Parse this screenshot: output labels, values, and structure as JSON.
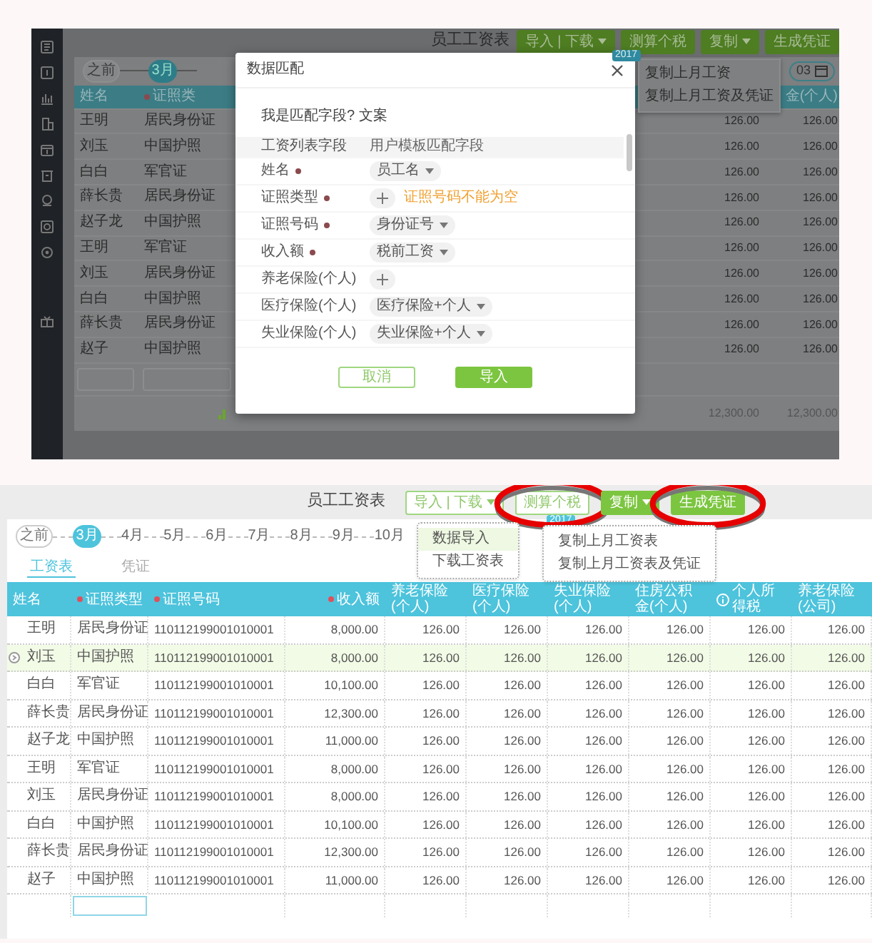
{
  "top_screen": {
    "title": "员工工资表",
    "buttons": [
      {
        "label": "导入 | 下载",
        "kind": "solid",
        "caret": true
      },
      {
        "label": "测算个税",
        "kind": "solid",
        "caret": false
      },
      {
        "label": "复制",
        "kind": "solid",
        "caret": true
      },
      {
        "label": "生成凭证",
        "kind": "solid",
        "caret": false
      }
    ],
    "badge": "2017",
    "timeline": [
      {
        "label": "之前",
        "selected": false
      },
      {
        "label": "3月",
        "selected": true
      }
    ],
    "date_field": "03",
    "copy_menu": [
      "复制上月工资",
      "复制上月工资及凭证"
    ],
    "left_columns": [
      {
        "label": "姓名",
        "required": false
      },
      {
        "label": "证照类",
        "required": true
      }
    ],
    "right_heading": "金(个人)",
    "rows": [
      {
        "name": "王明",
        "id_type": "居民身份证",
        "values": [
          "126.00",
          "126.00"
        ]
      },
      {
        "name": "刘玉",
        "id_type": "中国护照",
        "values": [
          "126.00",
          "126.00"
        ]
      },
      {
        "name": "白白",
        "id_type": "军官证",
        "values": [
          "126.00",
          "126.00"
        ]
      },
      {
        "name": "薛长贵",
        "id_type": "居民身份证",
        "values": [
          "126.00",
          "126.00"
        ]
      },
      {
        "name": "赵子龙",
        "id_type": "中国护照",
        "values": [
          "126.00",
          "126.00"
        ]
      },
      {
        "name": "王明",
        "id_type": "军官证",
        "values": [
          "126.00",
          "126.00"
        ]
      },
      {
        "name": "刘玉",
        "id_type": "居民身份证",
        "values": [
          "126.00",
          "126.00"
        ]
      },
      {
        "name": "白白",
        "id_type": "中国护照",
        "values": [
          "126.00",
          "126.00"
        ]
      },
      {
        "name": "薛长贵",
        "id_type": "居民身份证",
        "values": [
          "126.00",
          "126.00"
        ]
      },
      {
        "name": "赵子",
        "id_type": "中国护照",
        "values": [
          "126.00",
          "126.00"
        ]
      }
    ],
    "totals": [
      "12,300.00",
      "12,300.00"
    ]
  },
  "dialog": {
    "title": "数据匹配",
    "hint": "我是匹配字段? 文案",
    "columns": [
      "工资列表字段",
      "用户模板匹配字段"
    ],
    "rows": [
      {
        "field": "姓名",
        "required": true,
        "kind": "select",
        "value": "员工名"
      },
      {
        "field": "证照类型",
        "required": true,
        "kind": "add",
        "error": "证照号码不能为空"
      },
      {
        "field": "证照号码",
        "required": true,
        "kind": "select",
        "value": "身份证号"
      },
      {
        "field": "收入额",
        "required": true,
        "kind": "select",
        "value": "税前工资"
      },
      {
        "field": "养老保险(个人)",
        "required": false,
        "kind": "add"
      },
      {
        "field": "医疗保险(个人)",
        "required": false,
        "kind": "select",
        "value": "医疗保险+个人"
      },
      {
        "field": "失业保险(个人)",
        "required": false,
        "kind": "select",
        "value": "失业保险+个人"
      }
    ],
    "buttons": [
      {
        "label": "取消",
        "kind": "outline"
      },
      {
        "label": "导入",
        "kind": "solid"
      }
    ]
  },
  "bottom_screen": {
    "title": "员工工资表",
    "buttons": [
      {
        "label": "导入 | 下载",
        "kind": "outline",
        "caret": true,
        "circled": false
      },
      {
        "label": "测算个税",
        "kind": "outline",
        "caret": false,
        "circled": true
      },
      {
        "label": "复制",
        "kind": "solid",
        "caret": true,
        "circled": false
      },
      {
        "label": "生成凭证",
        "kind": "solid",
        "caret": false,
        "circled": true
      }
    ],
    "badge": "2017",
    "timeline": [
      {
        "label": "之前",
        "selected": false
      },
      {
        "label": "3月",
        "selected": true
      },
      {
        "label": "4月",
        "selected": false
      },
      {
        "label": "5月",
        "selected": false
      },
      {
        "label": "6月",
        "selected": false
      },
      {
        "label": "7月",
        "selected": false
      },
      {
        "label": "8月",
        "selected": false
      },
      {
        "label": "9月",
        "selected": false
      },
      {
        "label": "10月",
        "selected": false
      }
    ],
    "import_menu": [
      {
        "label": "数据导入",
        "selected": true
      },
      {
        "label": "下载工资表",
        "selected": false
      }
    ],
    "copy_menu": [
      "复制上月工资表",
      "复制上月工资表及凭证"
    ],
    "tabs": [
      {
        "label": "工资表",
        "selected": true
      },
      {
        "label": "凭证",
        "selected": false
      }
    ],
    "columns": [
      {
        "label": "姓名",
        "required": false,
        "info": false
      },
      {
        "label": "证照类型",
        "required": true,
        "info": false
      },
      {
        "label": "证照号码",
        "required": true,
        "info": false
      },
      {
        "label": "收入额",
        "required": true,
        "info": false
      },
      {
        "label": "养老保险(个人)",
        "required": false,
        "info": false
      },
      {
        "label": "医疗保险(个人)",
        "required": false,
        "info": false
      },
      {
        "label": "失业保险(个人)",
        "required": false,
        "info": false
      },
      {
        "label": "住房公积金(个人)",
        "required": false,
        "info": false
      },
      {
        "label": "个人所得税",
        "required": false,
        "info": true
      },
      {
        "label": "养老保险(公司)",
        "required": false,
        "info": false
      }
    ],
    "rows": [
      {
        "selected": false,
        "cells": [
          "王明",
          "居民身份证",
          "110112199001010001",
          "8,000.00",
          "126.00",
          "126.00",
          "126.00",
          "126.00",
          "126.00",
          "126.00"
        ]
      },
      {
        "selected": true,
        "cells": [
          "刘玉",
          "中国护照",
          "110112199001010001",
          "8,000.00",
          "126.00",
          "126.00",
          "126.00",
          "126.00",
          "126.00",
          "126.00"
        ]
      },
      {
        "selected": false,
        "cells": [
          "白白",
          "军官证",
          "110112199001010001",
          "10,100.00",
          "126.00",
          "126.00",
          "126.00",
          "126.00",
          "126.00",
          "126.00"
        ]
      },
      {
        "selected": false,
        "cells": [
          "薛长贵",
          "居民身份证",
          "110112199001010001",
          "12,300.00",
          "126.00",
          "126.00",
          "126.00",
          "126.00",
          "126.00",
          "126.00"
        ]
      },
      {
        "selected": false,
        "cells": [
          "赵子龙",
          "中国护照",
          "110112199001010001",
          "11,000.00",
          "126.00",
          "126.00",
          "126.00",
          "126.00",
          "126.00",
          "126.00"
        ]
      },
      {
        "selected": false,
        "cells": [
          "王明",
          "军官证",
          "110112199001010001",
          "8,000.00",
          "126.00",
          "126.00",
          "126.00",
          "126.00",
          "126.00",
          "126.00"
        ]
      },
      {
        "selected": false,
        "cells": [
          "刘玉",
          "居民身份证",
          "110112199001010001",
          "8,000.00",
          "126.00",
          "126.00",
          "126.00",
          "126.00",
          "126.00",
          "126.00"
        ]
      },
      {
        "selected": false,
        "cells": [
          "白白",
          "中国护照",
          "110112199001010001",
          "10,100.00",
          "126.00",
          "126.00",
          "126.00",
          "126.00",
          "126.00",
          "126.00"
        ]
      },
      {
        "selected": false,
        "cells": [
          "薛长贵",
          "居民身份证",
          "110112199001010001",
          "12,300.00",
          "126.00",
          "126.00",
          "126.00",
          "126.00",
          "126.00",
          "126.00"
        ]
      },
      {
        "selected": false,
        "cells": [
          "赵子",
          "中国护照",
          "110112199001010001",
          "11,000.00",
          "126.00",
          "126.00",
          "126.00",
          "126.00",
          "126.00",
          "126.00"
        ]
      }
    ]
  }
}
